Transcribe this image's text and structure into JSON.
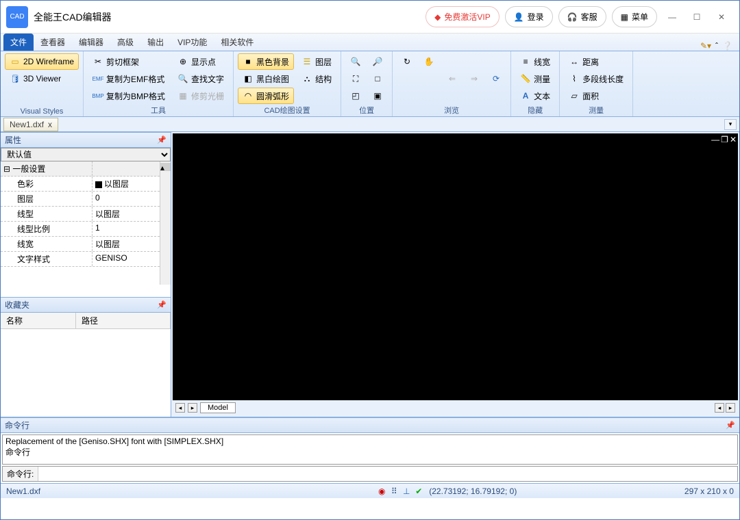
{
  "title": "全能王CAD编辑器",
  "titlebar": {
    "vip": "免费激活VIP",
    "login": "登录",
    "support": "客服",
    "menu": "菜单"
  },
  "tabs": [
    "文件",
    "查看器",
    "编辑器",
    "高级",
    "输出",
    "VIP功能",
    "相关软件"
  ],
  "ribbon": {
    "g1": {
      "wireframe": "2D Wireframe",
      "viewer": "3D Viewer",
      "label": "Visual Styles"
    },
    "g2": {
      "b1": "剪切框架",
      "b2": "复制为EMF格式",
      "b3": "复制为BMP格式",
      "label": "工具"
    },
    "g3": {
      "b1": "显示点",
      "b2": "查找文字",
      "b3": "修剪光栅",
      "label": ""
    },
    "g4": {
      "b1": "黑色背景",
      "b2": "黑白绘图",
      "b3": "圆滑弧形",
      "label": "CAD绘图设置"
    },
    "g5": {
      "b1": "图层",
      "b2": "结构"
    },
    "g6": {
      "label": "位置"
    },
    "g7": {
      "label": "浏览"
    },
    "g8": {
      "b1": "线宽",
      "b2": "测量",
      "b3": "文本",
      "label": "隐藏"
    },
    "g9": {
      "b1": "距离",
      "b2": "多段线长度",
      "b3": "面积",
      "label": "测量"
    }
  },
  "doc": {
    "name": "New1.dxf",
    "close": "x"
  },
  "panels": {
    "props": "属性",
    "fav": "收藏夹",
    "default": "默认值"
  },
  "props": {
    "group": "一般设置",
    "rows": [
      {
        "k": "色彩",
        "v": "以图层",
        "sq": true
      },
      {
        "k": "图层",
        "v": "0"
      },
      {
        "k": "线型",
        "v": "以图层"
      },
      {
        "k": "线型比例",
        "v": "1"
      },
      {
        "k": "线宽",
        "v": "以图层"
      },
      {
        "k": "文字样式",
        "v": "GENISO"
      }
    ]
  },
  "fav": {
    "c1": "名称",
    "c2": "路径"
  },
  "model": "Model",
  "cmd": {
    "title": "命令行",
    "log": "Replacement of the [Geniso.SHX] font with [SIMPLEX.SHX]",
    "prompt": "命令行",
    "label": "命令行:"
  },
  "status": {
    "file": "New1.dxf",
    "coords": "(22.73192; 16.79192; 0)",
    "dims": "297 x 210 x 0"
  }
}
